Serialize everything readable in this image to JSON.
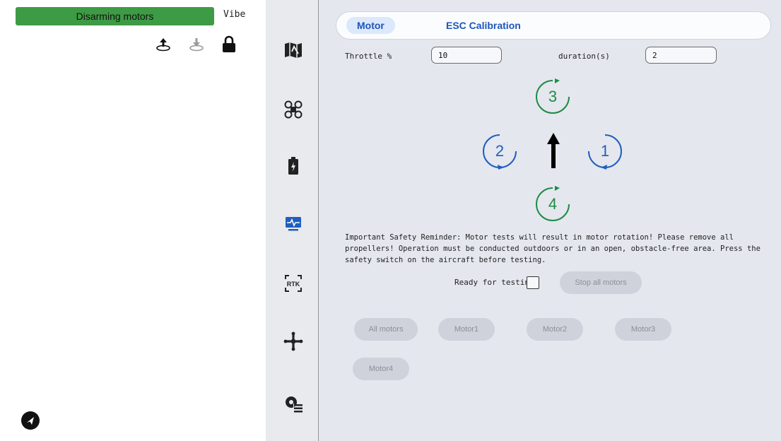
{
  "left_panel": {
    "status": "Disarming motors",
    "status_color": "#3e9b45",
    "vibe_label": "Vibe",
    "tools": [
      "upload-icon",
      "return-icon",
      "lock-icon"
    ],
    "bottom_icon": "send-icon"
  },
  "sidebar": {
    "items": [
      "map-icon",
      "drone-icon",
      "battery-icon",
      "monitor-icon",
      "rtk-icon",
      "motor-fan-icon",
      "settings-icon"
    ],
    "rtk_label": "RTK"
  },
  "tabs": [
    {
      "label": "Motor",
      "active": true
    },
    {
      "label": "ESC Calibration",
      "active": false
    }
  ],
  "throttle": {
    "label": "Throttle %",
    "value": "10"
  },
  "duration": {
    "label": "duration(s)",
    "value": "2"
  },
  "motors": [
    {
      "number": "1",
      "color": "#1f5fbf"
    },
    {
      "number": "2",
      "color": "#1f5fbf"
    },
    {
      "number": "3",
      "color": "#1e8a46"
    },
    {
      "number": "4",
      "color": "#1e8a46"
    }
  ],
  "reminder": "Important Safety Reminder: Motor tests will result in motor rotation! Please remove all propellers! Operation must be conducted outdoors or in an open, obstacle-free area. Press the safety switch on the aircraft before testing.",
  "ready_label": "Ready for testing",
  "ready_checked": false,
  "stop_button": "Stop all motors",
  "motor_buttons": [
    "All motors",
    "Motor1",
    "Motor2",
    "Motor3",
    "Motor4"
  ],
  "accent_color": "#1d56b8"
}
